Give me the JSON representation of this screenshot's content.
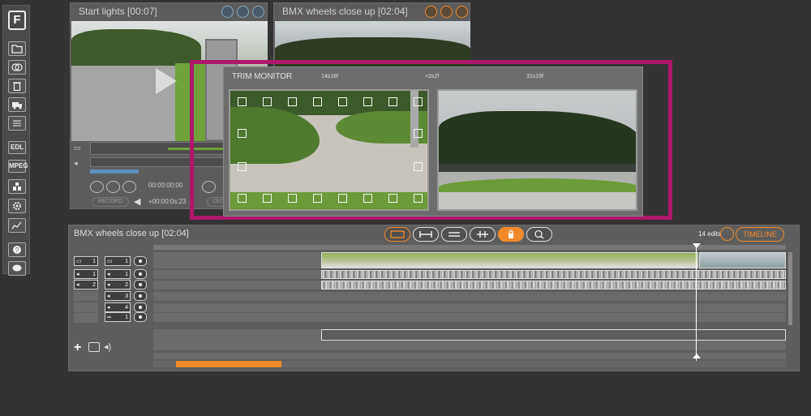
{
  "toolbar": {
    "logo": "F",
    "edl_label": "EDL",
    "mpeg_label": "MPEG"
  },
  "panel_left": {
    "title": "Start lights [00:07]",
    "timecode_in": "00:00:00:00",
    "timecode_out": "+00:00:0s:23",
    "btn_record": "RECORD",
    "btn_out": "OUT"
  },
  "panel_right": {
    "title": "BMX wheels close up [02:04]"
  },
  "trim_monitor": {
    "title": "TRIM MONITOR",
    "left_time": "14s18f",
    "offset": "+2s2f",
    "right_time": "31s19f"
  },
  "timeline": {
    "title": "BMX wheels close up [02:04]",
    "edits": "14 edits",
    "timeline_button": "TIMELINE",
    "tracks": [
      {
        "label": "1",
        "type": "video"
      },
      {
        "label": "1",
        "type": "audio"
      },
      {
        "label": "2",
        "type": "audio"
      },
      {
        "label": "3",
        "type": "audio"
      },
      {
        "label": "4",
        "type": "audio"
      },
      {
        "label": "1",
        "type": "text"
      }
    ],
    "monitor_channels": [
      {
        "label": "1",
        "type": "video"
      },
      {
        "label": "1",
        "type": "audio"
      },
      {
        "label": "2",
        "type": "audio"
      }
    ],
    "scroll_position": 0.25
  },
  "colors": {
    "accent": "#f28a2c",
    "trim_border": "#b0176a",
    "panel": "#5c5c5c",
    "background": "#333333"
  }
}
